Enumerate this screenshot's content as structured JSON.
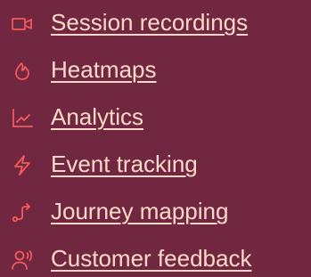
{
  "colors": {
    "background": "#722740",
    "link_text": "#fcd9c8",
    "icon": "#f15b5b"
  },
  "nav": {
    "items": [
      {
        "label": "Session recordings",
        "icon": "video-camera-icon"
      },
      {
        "label": "Heatmaps",
        "icon": "flame-icon"
      },
      {
        "label": "Analytics",
        "icon": "line-chart-icon"
      },
      {
        "label": "Event tracking",
        "icon": "lightning-icon"
      },
      {
        "label": "Journey mapping",
        "icon": "route-icon"
      },
      {
        "label": "Customer feedback",
        "icon": "speaking-person-icon"
      }
    ]
  }
}
